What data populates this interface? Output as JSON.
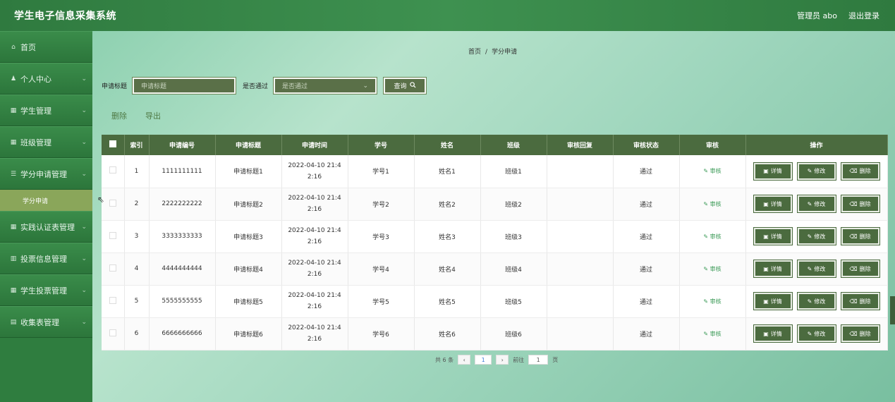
{
  "app": {
    "title": "学生电子信息采集系统"
  },
  "topbar": {
    "user": "管理员 abo",
    "logout": "退出登录"
  },
  "sidebar": {
    "items": [
      {
        "label": "首页",
        "icon": "home-icon",
        "glyph": "⌂",
        "chev": ""
      },
      {
        "label": "个人中心",
        "icon": "user-icon",
        "glyph": "♟",
        "chev": "⌄"
      },
      {
        "label": "学生管理",
        "icon": "grid-icon",
        "glyph": "▦",
        "chev": "⌄"
      },
      {
        "label": "班级管理",
        "icon": "grid-icon",
        "glyph": "▦",
        "chev": "⌄"
      },
      {
        "label": "学分申请管理",
        "icon": "list-icon",
        "glyph": "☰",
        "chev": "⌄"
      },
      {
        "label": "实践认证表管理",
        "icon": "grid-icon",
        "glyph": "▦",
        "chev": "⌄"
      },
      {
        "label": "投票信息管理",
        "icon": "chart-icon",
        "glyph": "▥",
        "chev": "⌄"
      },
      {
        "label": "学生投票管理",
        "icon": "grid-icon",
        "glyph": "▦",
        "chev": "⌄"
      },
      {
        "label": "收集表管理",
        "icon": "doc-icon",
        "glyph": "▤",
        "chev": "⌄"
      }
    ],
    "active_sub": "学分申请"
  },
  "breadcrumb": {
    "home": "首页",
    "sep": "/",
    "current": "学分申请"
  },
  "search": {
    "title_label": "申请标题",
    "title_placeholder": "申请标题",
    "pass_label": "是否通过",
    "pass_placeholder": "是否通过",
    "query_label": "查询",
    "query_icon": "search-icon"
  },
  "actions": {
    "delete": "删除",
    "export": "导出"
  },
  "table": {
    "headers": [
      "索引",
      "申请编号",
      "申请标题",
      "申请时间",
      "学号",
      "姓名",
      "班级",
      "审核回复",
      "审核状态",
      "审核",
      "操作"
    ],
    "rows": [
      {
        "index": "1",
        "no": "1111111111",
        "title": "申请标题1",
        "time1": "2022-04-10 21:4",
        "time2": "2:16",
        "sid": "学号1",
        "name": "姓名1",
        "cls": "班级1",
        "reply": "",
        "status": "通过",
        "audit": "✎ 审核"
      },
      {
        "index": "2",
        "no": "2222222222",
        "title": "申请标题2",
        "time1": "2022-04-10 21:4",
        "time2": "2:16",
        "sid": "学号2",
        "name": "姓名2",
        "cls": "班级2",
        "reply": "",
        "status": "通过",
        "audit": "✎ 审核"
      },
      {
        "index": "3",
        "no": "3333333333",
        "title": "申请标题3",
        "time1": "2022-04-10 21:4",
        "time2": "2:16",
        "sid": "学号3",
        "name": "姓名3",
        "cls": "班级3",
        "reply": "",
        "status": "通过",
        "audit": "✎ 审核"
      },
      {
        "index": "4",
        "no": "4444444444",
        "title": "申请标题4",
        "time1": "2022-04-10 21:4",
        "time2": "2:16",
        "sid": "学号4",
        "name": "姓名4",
        "cls": "班级4",
        "reply": "",
        "status": "通过",
        "audit": "✎ 审核"
      },
      {
        "index": "5",
        "no": "5555555555",
        "title": "申请标题5",
        "time1": "2022-04-10 21:4",
        "time2": "2:16",
        "sid": "学号5",
        "name": "姓名5",
        "cls": "班级5",
        "reply": "",
        "status": "通过",
        "audit": "✎ 审核"
      },
      {
        "index": "6",
        "no": "6666666666",
        "title": "申请标题6",
        "time1": "2022-04-10 21:4",
        "time2": "2:16",
        "sid": "学号6",
        "name": "姓名6",
        "cls": "班级6",
        "reply": "",
        "status": "通过",
        "audit": "✎ 审核"
      }
    ],
    "ops": {
      "detail": "详情",
      "edit": "修改",
      "delete": "删除"
    }
  },
  "pagination": {
    "total": "共 6 条",
    "current": "1",
    "goto_label": "前往",
    "goto_value": "1",
    "page_suffix": "页",
    "prev": "‹",
    "next": "›"
  },
  "colors": {
    "topbar": "#3e9150",
    "sidebar": "#2f7d3f",
    "table_header": "#4b6b3f",
    "active_sub": "#8aa65a"
  }
}
